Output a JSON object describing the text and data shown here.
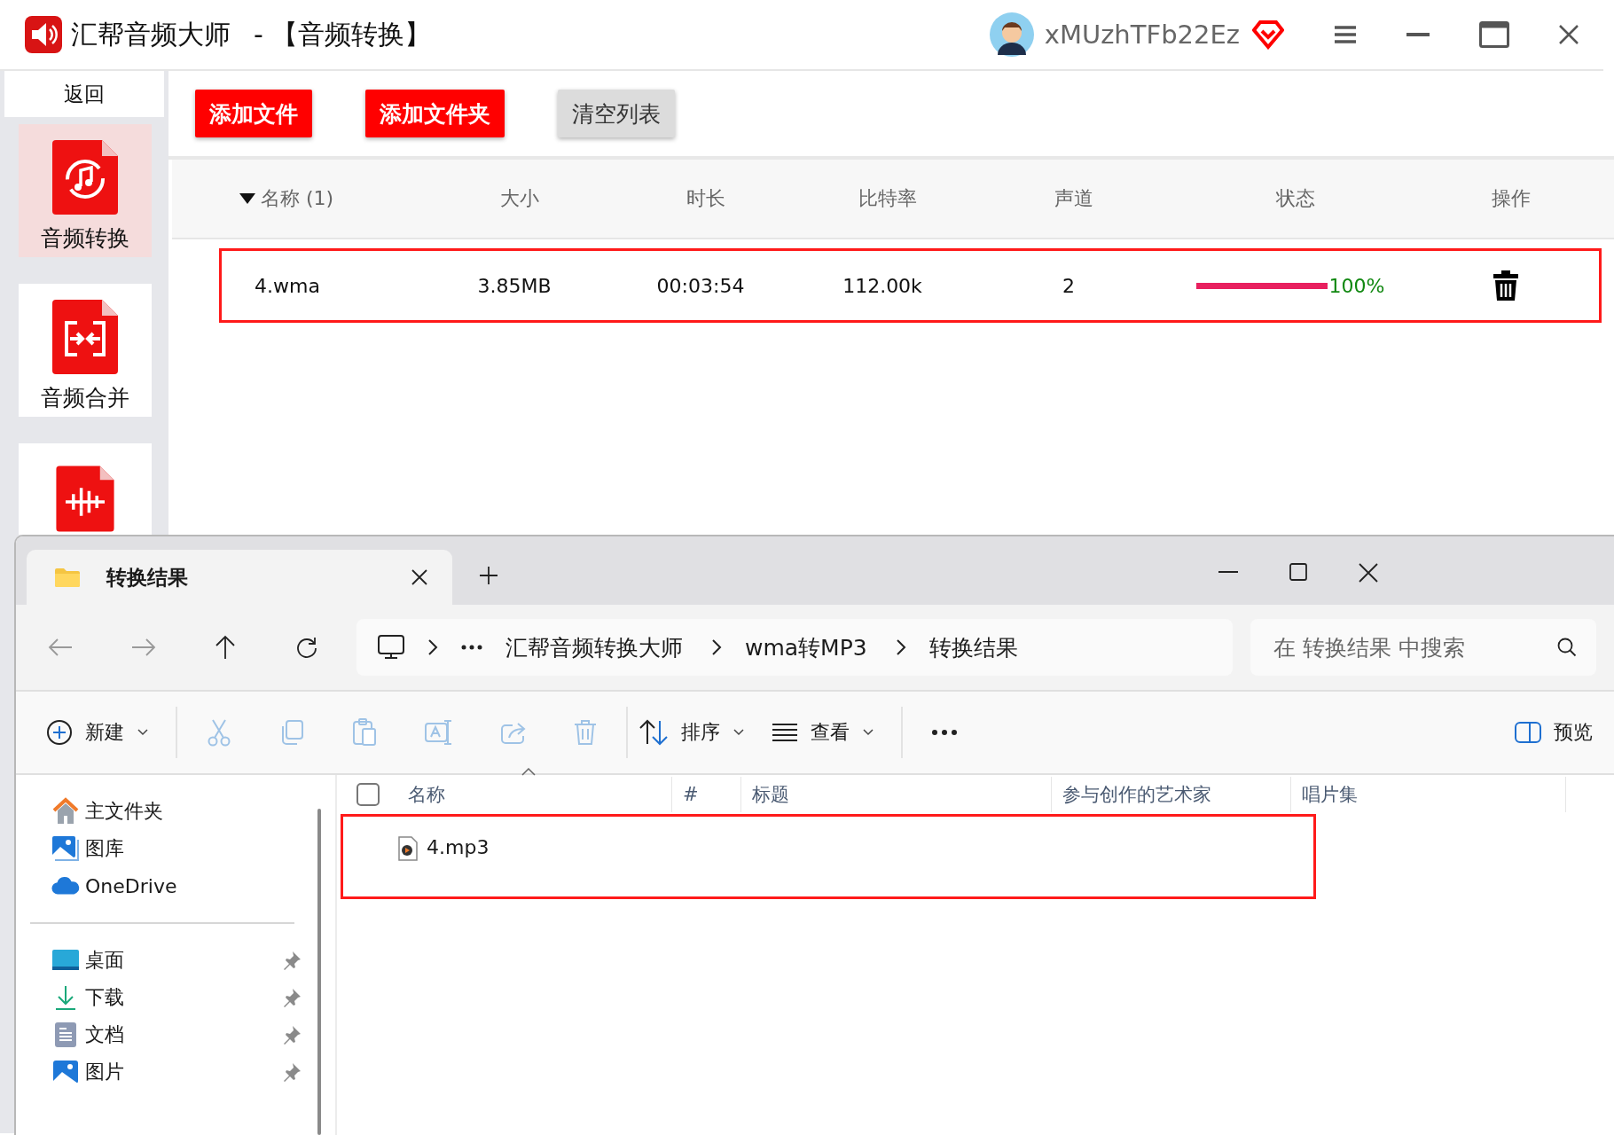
{
  "app": {
    "title": "汇帮音频大师",
    "subtitle": "-  【音频转换】",
    "username": "xMUzhTFb22Ez",
    "back": "返回",
    "sidebar": [
      {
        "label": "音频转换",
        "kind": "convert",
        "selected": true
      },
      {
        "label": "音频合并",
        "kind": "merge",
        "selected": false
      },
      {
        "kind": "compress",
        "selected": false
      }
    ],
    "toolbar": [
      {
        "label": "添加文件",
        "kind": "primary"
      },
      {
        "label": "添加文件夹",
        "kind": "primary"
      },
      {
        "label": "清空列表",
        "kind": "secondary"
      }
    ],
    "table": {
      "columns": [
        "名称 (1)",
        "大小",
        "时长",
        "比特率",
        "声道",
        "状态",
        "操作"
      ],
      "rows": [
        {
          "name": "4.wma",
          "size": "3.85MB",
          "duration": "00:03:54",
          "bitrate": "112.00k",
          "channels": "2",
          "level": 1,
          "progress": "100%",
          "highlighted": true
        }
      ]
    }
  },
  "explorer": {
    "tabs": [
      {
        "label": "转换结果",
        "selected": true
      }
    ],
    "breadcrumb": [
      "汇帮音频转换大师",
      "wma转MP3",
      "转换结果"
    ],
    "search": {
      "placeholder": "在 转换结果 中搜索"
    },
    "commands": [
      {
        "kind": "new",
        "label": "新建",
        "disabled": false
      },
      {
        "kind": "cut",
        "disabled": true
      },
      {
        "kind": "copy",
        "disabled": true
      },
      {
        "kind": "paste",
        "disabled": true
      },
      {
        "kind": "rename",
        "disabled": true
      },
      {
        "kind": "share",
        "disabled": true
      },
      {
        "kind": "delete",
        "disabled": true
      },
      {
        "kind": "sort",
        "label": "排序",
        "disabled": false
      },
      {
        "kind": "view",
        "label": "查看",
        "disabled": false
      },
      {
        "kind": "more",
        "disabled": false
      }
    ],
    "preview": "预览",
    "nav": [
      {
        "label": "主文件夹",
        "kind": "home"
      },
      {
        "label": "图库",
        "kind": "gallery"
      },
      {
        "label": "OneDrive",
        "kind": "cloud"
      }
    ],
    "pinned": [
      {
        "label": "桌面",
        "kind": "desktop"
      },
      {
        "label": "下载",
        "kind": "download"
      },
      {
        "label": "文档",
        "kind": "document"
      },
      {
        "label": "图片",
        "kind": "picture"
      }
    ],
    "select_all": {
      "checked": false
    },
    "columns": [
      "名称",
      "#",
      "标题",
      "参与创作的艺术家",
      "唱片集"
    ],
    "files": [
      {
        "name": "4.mp3",
        "highlighted": true
      }
    ]
  }
}
